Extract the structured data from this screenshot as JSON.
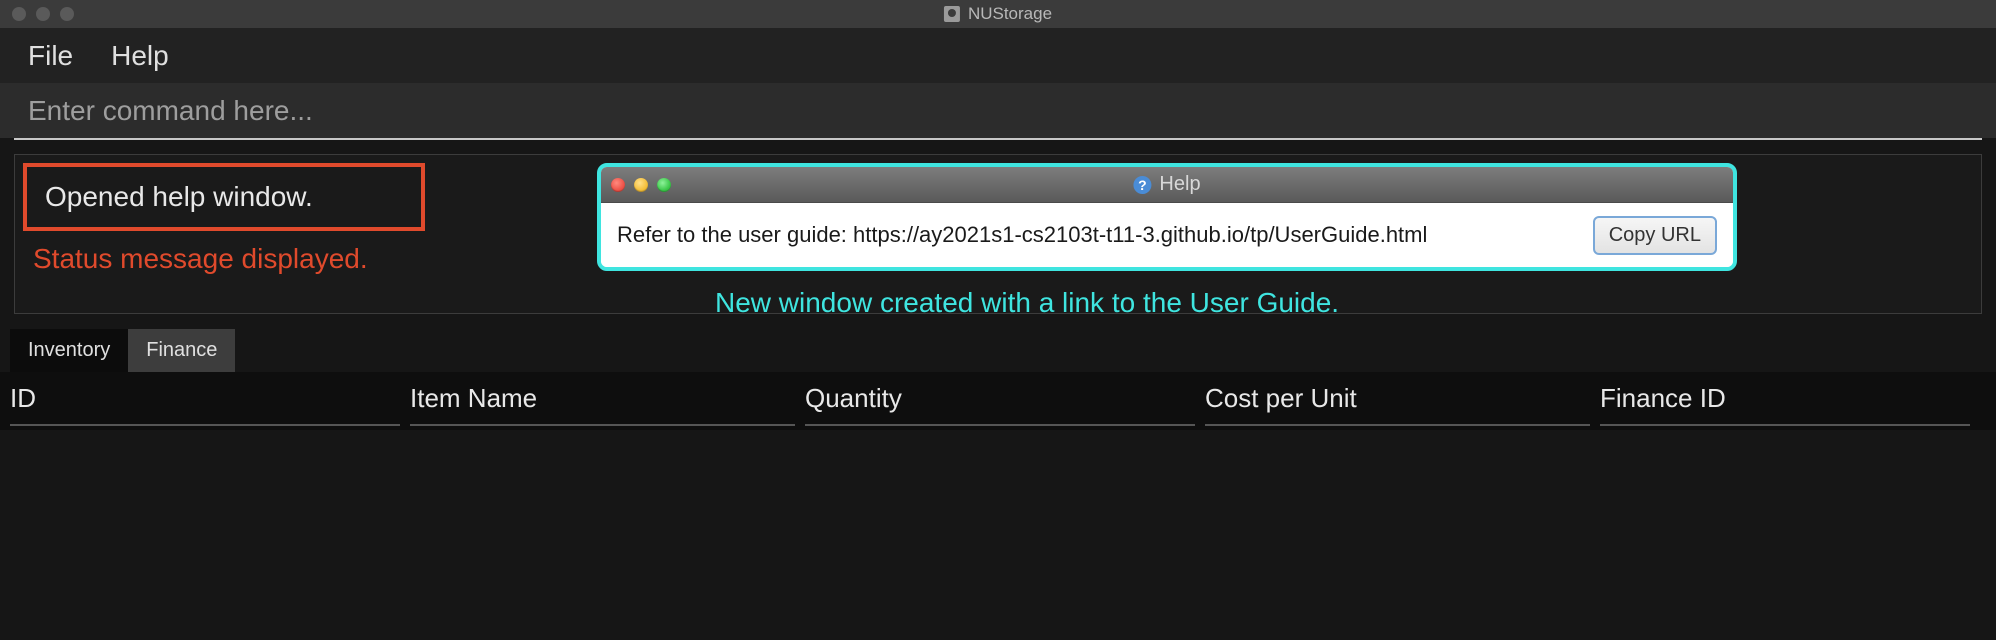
{
  "window": {
    "title": "NUStorage"
  },
  "menu": {
    "file": "File",
    "help": "Help"
  },
  "command": {
    "placeholder": "Enter command here..."
  },
  "status": {
    "message": "Opened help window."
  },
  "annotation": {
    "red": "Status message displayed.",
    "cyan": "New window created with a link to the User Guide."
  },
  "help_popup": {
    "title": "Help",
    "text": "Refer to the user guide: https://ay2021s1-cs2103t-t11-3.github.io/tp/UserGuide.html",
    "button": "Copy URL"
  },
  "tabs": {
    "inventory": "Inventory",
    "finance": "Finance"
  },
  "columns": {
    "id": "ID",
    "item_name": "Item Name",
    "quantity": "Quantity",
    "cost_per_unit": "Cost per Unit",
    "finance_id": "Finance ID"
  }
}
